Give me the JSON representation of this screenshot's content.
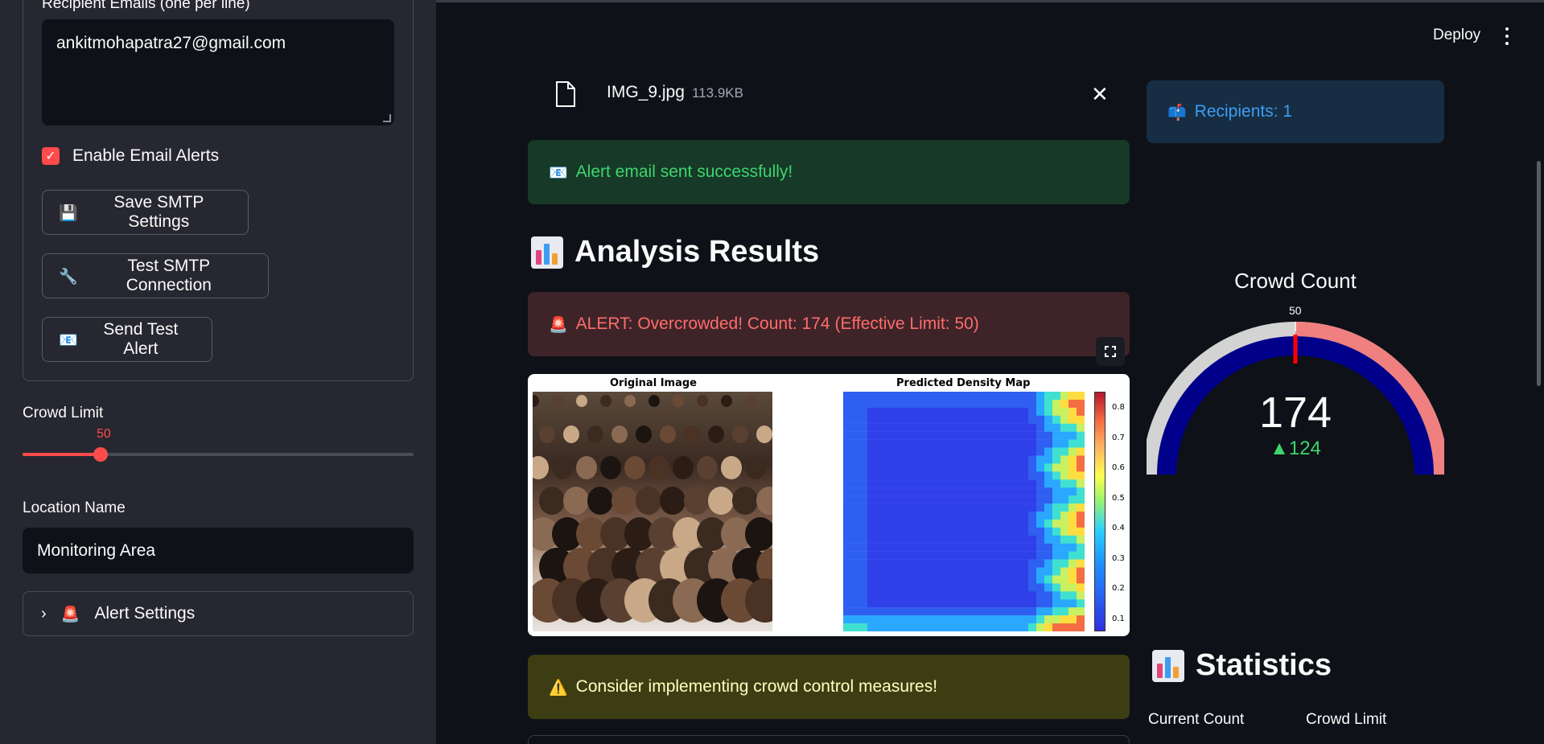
{
  "sidebar": {
    "recipient_label": "Recipient Emails (one per line)",
    "recipient_value": "ankitmohapatra27@gmail.com",
    "enable_alerts_label": "Enable Email Alerts",
    "enable_alerts_checked": true,
    "save_button": "Save SMTP Settings",
    "save_icon": "floppy-disk-icon",
    "test_button": "Test SMTP Connection",
    "test_icon": "wrench-icon",
    "send_button": "Send Test Alert",
    "send_icon": "envelope-icon",
    "crowd_limit_label": "Crowd Limit",
    "crowd_limit_value": "50",
    "crowd_limit_fraction": 0.2,
    "location_label": "Location Name",
    "location_value": "Monitoring Area",
    "alert_settings_label": "Alert Settings",
    "alert_settings_icon": "siren-icon"
  },
  "header": {
    "deploy_label": "Deploy"
  },
  "file": {
    "name": "IMG_9.jpg",
    "size": "113.9KB"
  },
  "messages": {
    "success": "Alert email sent successfully!",
    "error": "ALERT: Overcrowded! Count: 174 (Effective Limit: 50)",
    "warning": "Consider implementing crowd control measures!",
    "info": "Recipients: 1"
  },
  "headings": {
    "analysis": "Analysis Results",
    "statistics": "Statistics"
  },
  "figure": {
    "original_title": "Original Image",
    "density_title": "Predicted Density Map",
    "colorbar_ticks": [
      "0.8",
      "0.7",
      "0.6",
      "0.5",
      "0.4",
      "0.3",
      "0.2",
      "0.1"
    ]
  },
  "gauge": {
    "title": "Crowd Count",
    "threshold_label": "50",
    "value": "174",
    "delta": "▲124",
    "colors": {
      "bar": "#00008b",
      "background": "#d3d3d3",
      "danger": "#f08080",
      "threshold": "#ff0000"
    }
  },
  "metrics": {
    "current_count_label": "Current Count",
    "crowd_limit_label": "Crowd Limit"
  },
  "colors": {
    "accent": "#ff4b4b",
    "success_text": "#3dd56d",
    "info_text": "#3d9df3"
  }
}
